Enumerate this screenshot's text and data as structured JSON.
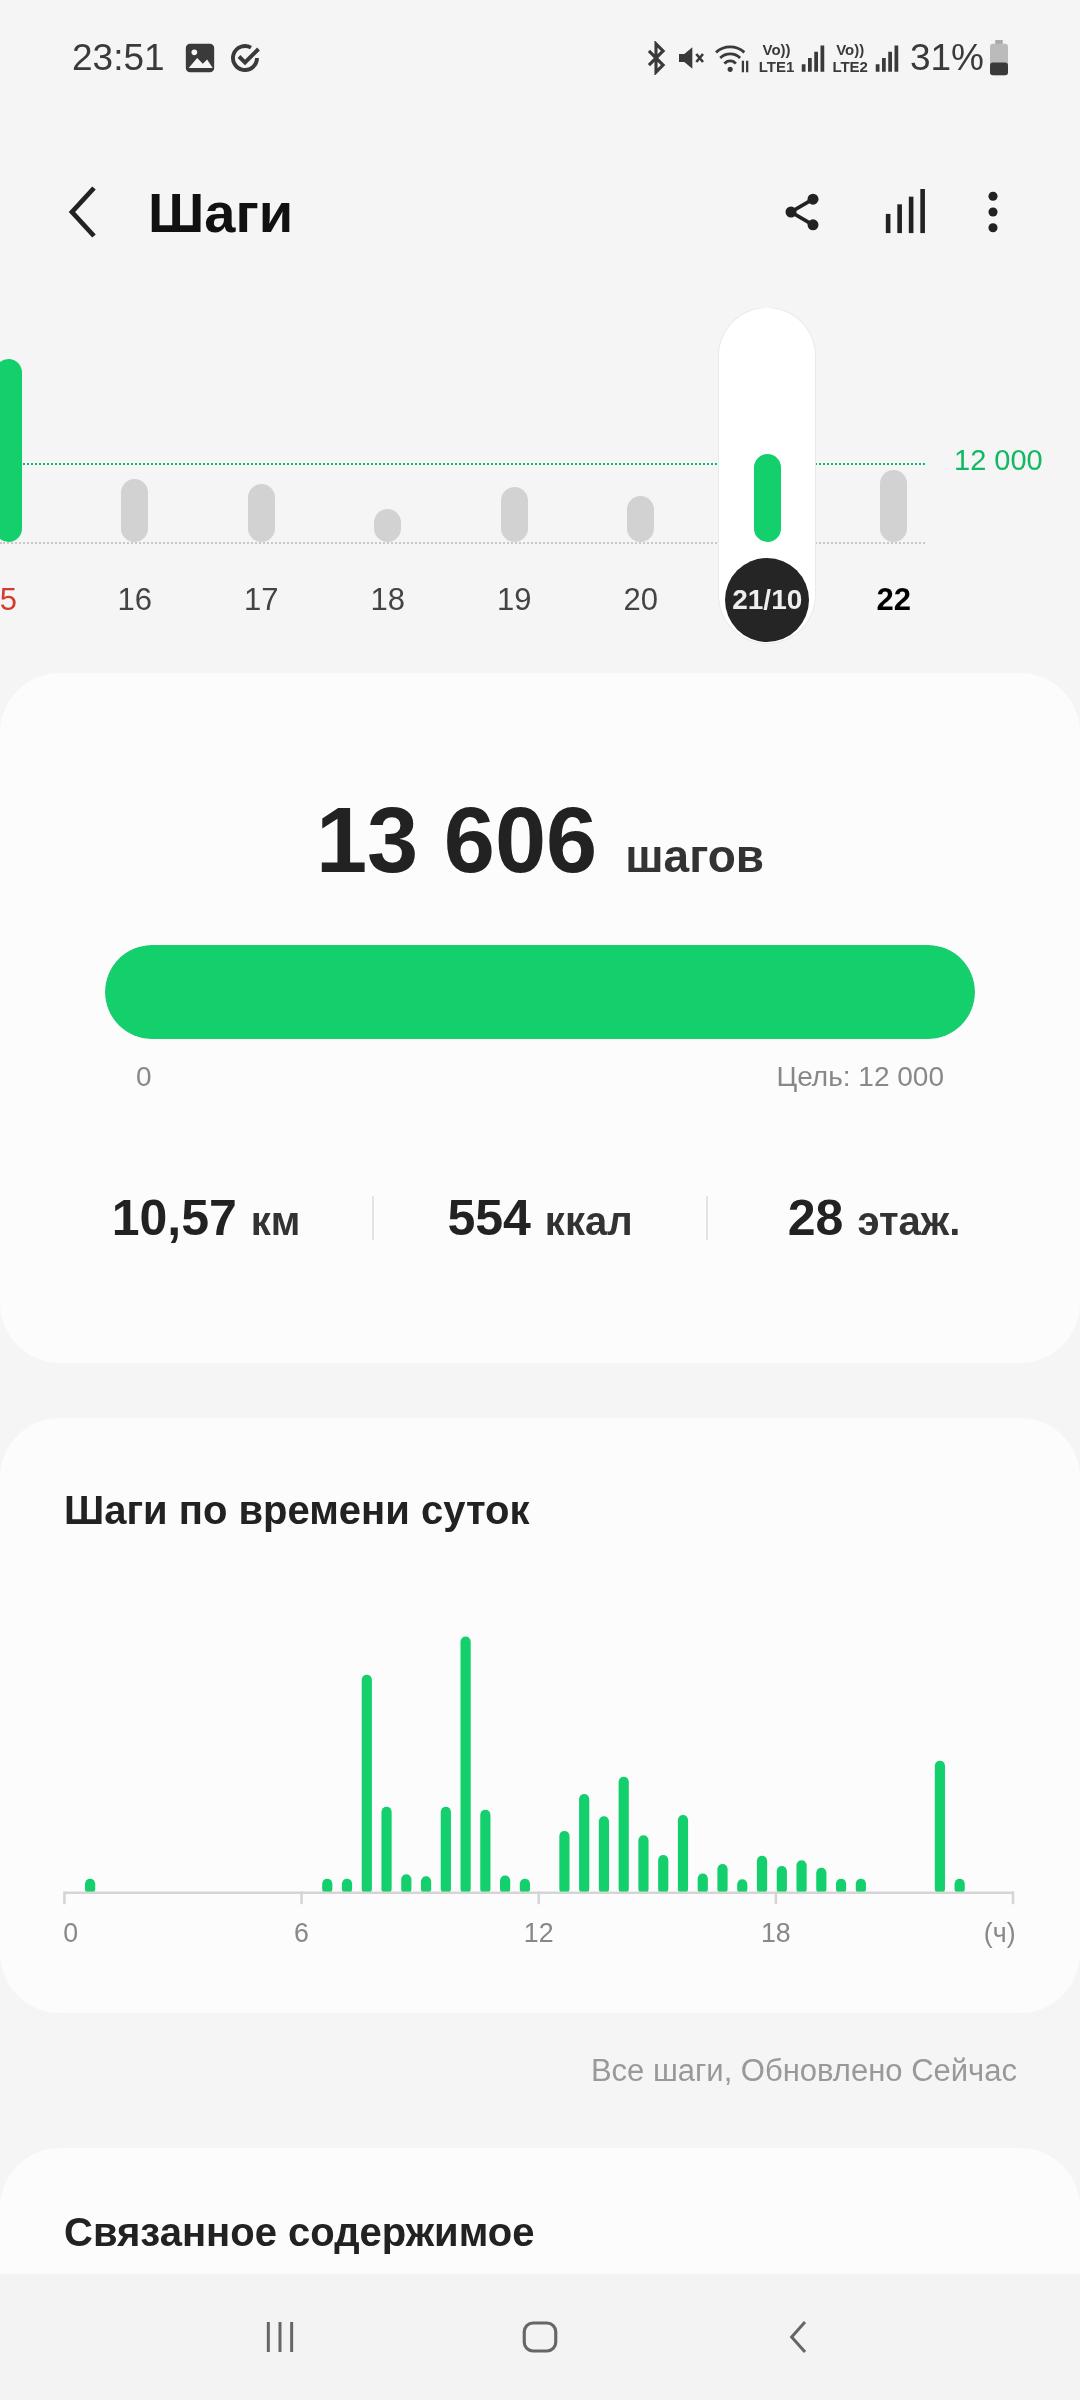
{
  "status_bar": {
    "time": "23:51",
    "sims": [
      {
        "top": "Vo))",
        "bottom": "LTE1"
      },
      {
        "top": "Vo))",
        "bottom": "LTE2"
      }
    ],
    "battery": "31%"
  },
  "header": {
    "title": "Шаги"
  },
  "day_strip": {
    "goal_label": "12 000",
    "days": [
      {
        "label": "5",
        "selected": false,
        "weekend": true,
        "goal_reached": true,
        "today": false
      },
      {
        "label": "16",
        "selected": false,
        "weekend": false,
        "goal_reached": false,
        "today": false
      },
      {
        "label": "17",
        "selected": false,
        "weekend": false,
        "goal_reached": false,
        "today": false
      },
      {
        "label": "18",
        "selected": false,
        "weekend": false,
        "goal_reached": false,
        "today": false
      },
      {
        "label": "19",
        "selected": false,
        "weekend": false,
        "goal_reached": false,
        "today": false
      },
      {
        "label": "20",
        "selected": false,
        "weekend": false,
        "goal_reached": false,
        "today": false
      },
      {
        "label": "21/10",
        "selected": true,
        "weekend": false,
        "goal_reached": true,
        "today": false
      },
      {
        "label": "22",
        "selected": false,
        "weekend": false,
        "goal_reached": false,
        "today": true
      }
    ]
  },
  "summary": {
    "count": "13 606",
    "unit": "шагов",
    "progress": {
      "level": 1,
      "min_label": "0",
      "goal_label": "Цель: 12 000"
    },
    "stats": [
      {
        "value": "10,57",
        "unit": "км"
      },
      {
        "value": "554",
        "unit": "ккал"
      },
      {
        "value": "28",
        "unit": "этаж."
      }
    ]
  },
  "hourly": {
    "title": "Шаги по времени суток",
    "axis_labels": [
      "0",
      "6",
      "12",
      "18",
      "(ч)"
    ]
  },
  "footnote": "Все шаги, Обновлено Сейчас",
  "related": {
    "title": "Связанное содержимое"
  }
}
